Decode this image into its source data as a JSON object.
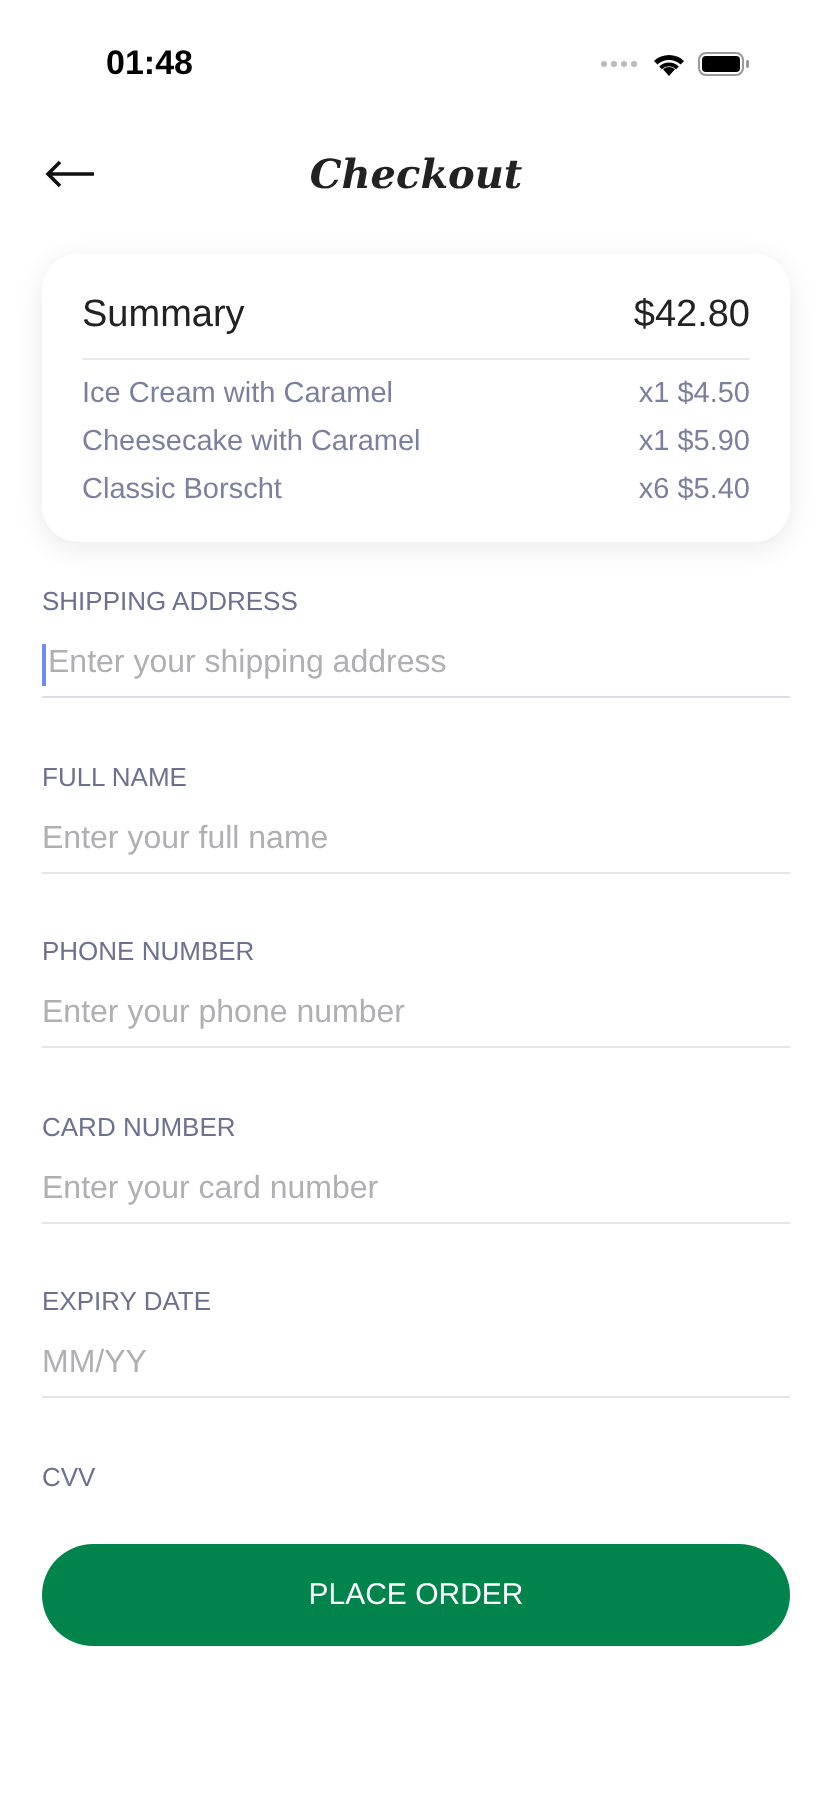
{
  "status_bar": {
    "time": "01:48"
  },
  "header": {
    "title": "Checkout"
  },
  "summary": {
    "title": "Summary",
    "total": "$42.80",
    "items": [
      {
        "name": "Ice Cream with Caramel",
        "qty_price": "x1 $4.50"
      },
      {
        "name": "Cheesecake with Caramel",
        "qty_price": "x1 $5.90"
      },
      {
        "name": "Classic Borscht",
        "qty_price": "x6 $5.40"
      }
    ]
  },
  "fields": [
    {
      "label": "SHIPPING ADDRESS",
      "placeholder": "Enter your shipping address",
      "focused": true
    },
    {
      "label": "FULL NAME",
      "placeholder": "Enter your full name",
      "focused": false
    },
    {
      "label": "PHONE NUMBER",
      "placeholder": "Enter your phone number",
      "focused": false
    },
    {
      "label": "CARD NUMBER",
      "placeholder": "Enter your card number",
      "focused": false
    },
    {
      "label": "EXPIRY DATE",
      "placeholder": "MM/YY",
      "focused": false
    },
    {
      "label": "CVV"
    }
  ],
  "button": {
    "label": "PLACE ORDER"
  }
}
